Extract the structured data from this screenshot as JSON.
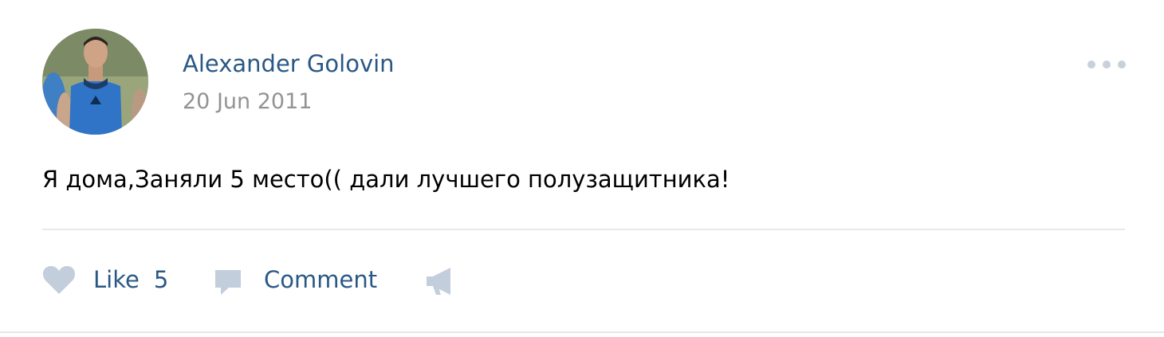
{
  "post": {
    "author": "Alexander Golovin",
    "date": "20 Jun 2011",
    "text": "Я дома,Заняли 5 место(( дали лучшего полузащитника!"
  },
  "actions": {
    "like_label": "Like",
    "like_count": "5",
    "comment_label": "Comment"
  },
  "icons": {
    "more": "more-dots-icon",
    "like": "heart-icon",
    "comment": "speech-bubble-icon",
    "share": "megaphone-icon"
  },
  "colors": {
    "link": "#2a5885",
    "date": "#939393",
    "icon": "#c3cedc",
    "divider": "#e7e8ec",
    "text": "#000000"
  }
}
